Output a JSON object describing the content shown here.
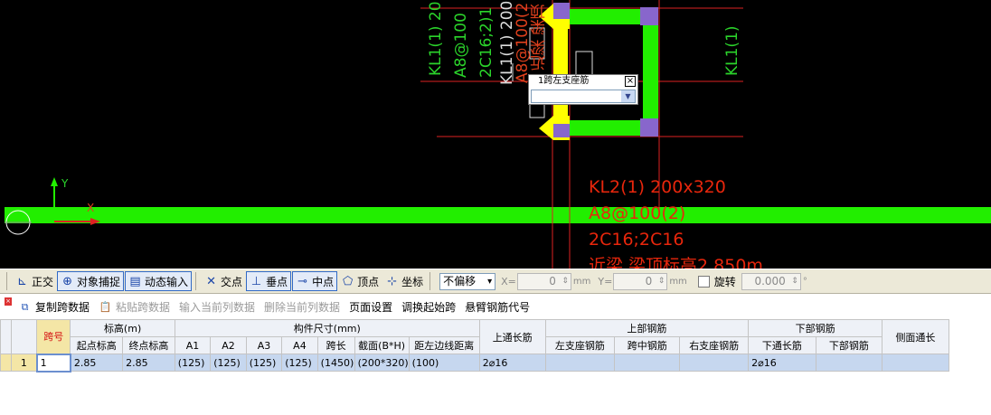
{
  "canvas": {
    "popup": {
      "title": "1跨左支座筋",
      "close_glyph": "×",
      "value": ""
    },
    "texts": {
      "kl1_left": "KL1(1) 20",
      "a8_left": "A8@100",
      "c16_left": "2C16;2)1",
      "mid_frag_a": "KL1(1) 200",
      "mid_frag_b": "A8@100(2",
      "mid_frag_c": "近梁 梁顶",
      "kl1_right": "KL1(1)",
      "kl2_line1": "KL2(1) 200x320",
      "kl2_line2": "A8@100(2)",
      "kl2_line3": "2C16;2C16",
      "kl2_line4": "近梁 梁顶标高2.850m",
      "axis_y": "Y",
      "axis_x": "X"
    },
    "colors": {
      "background": "#000000",
      "green_beam": "#22ee00",
      "yellow_column": "#ffff00",
      "purple_node": "#8866cc",
      "red_line": "#dd2222"
    }
  },
  "snapbar": {
    "items": [
      {
        "label": "正交",
        "icon": "ortho-icon",
        "on": false
      },
      {
        "label": "对象捕捉",
        "icon": "object-snap-icon",
        "on": true
      },
      {
        "label": "动态输入",
        "icon": "dynamic-input-icon",
        "on": true
      },
      {
        "label": "交点",
        "icon": "intersection-icon",
        "on": false
      },
      {
        "label": "垂点",
        "icon": "perpendicular-icon",
        "on": true
      },
      {
        "label": "中点",
        "icon": "midpoint-icon",
        "on": true
      },
      {
        "label": "顶点",
        "icon": "vertex-icon",
        "on": false
      },
      {
        "label": "坐标",
        "icon": "coordinate-icon",
        "on": false
      }
    ],
    "offset_mode": "不偏移",
    "x_label": "X=",
    "x_value": "0",
    "y_label": "Y=",
    "y_value": "0",
    "unit": "mm",
    "rotate_label": "旋转",
    "rotate_value": "0.000",
    "degree": "°"
  },
  "panel_toolbar": {
    "items": [
      {
        "label": "复制跨数据",
        "icon": "copy-span-icon",
        "enabled": true
      },
      {
        "label": "粘贴跨数据",
        "icon": "paste-span-icon",
        "enabled": false
      },
      {
        "label": "输入当前列数据",
        "icon": "",
        "enabled": false
      },
      {
        "label": "删除当前列数据",
        "icon": "",
        "enabled": false
      },
      {
        "label": "页面设置",
        "icon": "",
        "enabled": true
      },
      {
        "label": "调换起始跨",
        "icon": "",
        "enabled": true
      },
      {
        "label": "悬臂钢筋代号",
        "icon": "",
        "enabled": true
      }
    ]
  },
  "grid": {
    "headers_top": {
      "span_no": "跨号",
      "elevation": "标高(m)",
      "dimensions": "构件尺寸(mm)",
      "top_through": "上通长筋",
      "top_rebar": "上部钢筋",
      "bottom_rebar": "下部钢筋",
      "side_through": "侧面通长"
    },
    "headers_sub": [
      "起点标高",
      "终点标高",
      "A1",
      "A2",
      "A3",
      "A4",
      "跨长",
      "截面(B*H)",
      "距左边线距离",
      "左支座钢筋",
      "跨中钢筋",
      "右支座钢筋",
      "下通长筋",
      "下部钢筋"
    ],
    "rows": [
      {
        "row_no": "1",
        "span": "1",
        "start_elev": "2.85",
        "end_elev": "2.85",
        "a1": "(125)",
        "a2": "(125)",
        "a3": "(125)",
        "a4": "(125)",
        "span_len": "(1450)",
        "section": "(200*320)",
        "left_dist": "(100)",
        "top_through": "2⌀16",
        "left_support": "",
        "mid_span": "",
        "right_support": "",
        "bottom_through": "2⌀16",
        "bottom_rebar": "",
        "side": ""
      }
    ]
  }
}
